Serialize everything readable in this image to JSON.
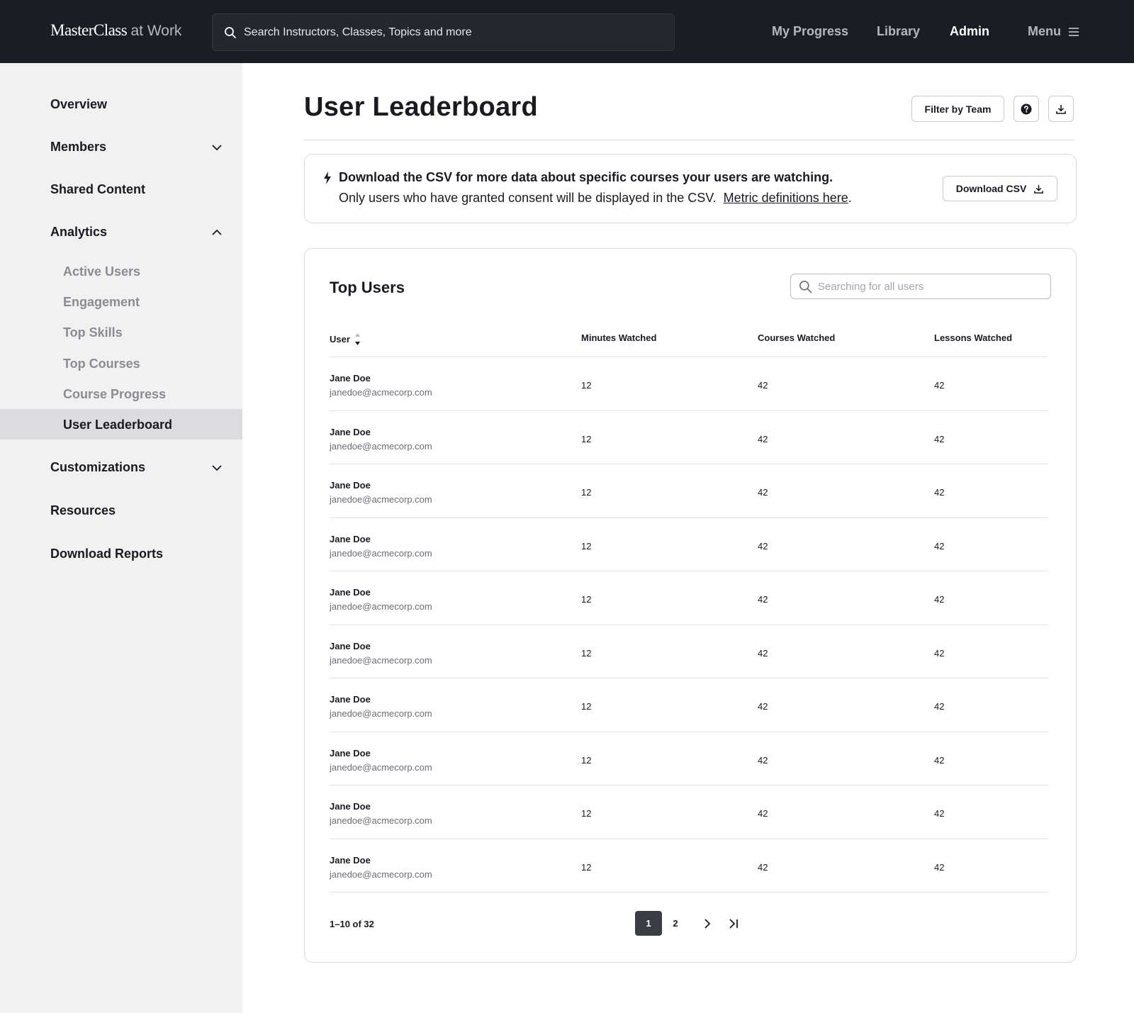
{
  "header": {
    "brand": "MasterClass",
    "brand_suffix": "at Work",
    "search_placeholder": "Search Instructors, Classes, Topics and more",
    "nav": [
      {
        "label": "My Progress"
      },
      {
        "label": "Library"
      },
      {
        "label": "Admin",
        "active": true
      }
    ],
    "menu_label": "Menu"
  },
  "sidebar": {
    "items": [
      {
        "label": "Overview"
      },
      {
        "label": "Members",
        "expandable": true,
        "expanded": false
      },
      {
        "label": "Shared Content"
      },
      {
        "label": "Analytics",
        "expandable": true,
        "expanded": true
      },
      {
        "label": "Customizations",
        "expandable": true,
        "expanded": false
      },
      {
        "label": "Resources"
      },
      {
        "label": "Download Reports"
      }
    ],
    "analytics_subitems": [
      {
        "label": "Active Users"
      },
      {
        "label": "Engagement"
      },
      {
        "label": "Top Skills"
      },
      {
        "label": "Top Courses"
      },
      {
        "label": "Course Progress"
      },
      {
        "label": "User Leaderboard",
        "active": true
      }
    ]
  },
  "main": {
    "title": "User Leaderboard",
    "filter_label": "Filter by Team",
    "info": {
      "headline": "Download the CSV for more data about specific courses your users are watching.",
      "text": "Only users who have granted consent will be displayed in the CSV.",
      "link_text": "Metric definitions here",
      "link_suffix": ".",
      "download_label": "Download CSV"
    },
    "table": {
      "title": "Top Users",
      "search_placeholder": "Searching for all users",
      "columns": [
        "User",
        "Minutes Watched",
        "Courses Watched",
        "Lessons Watched"
      ],
      "rows": [
        {
          "name": "Jane Doe",
          "email": "janedoe@acmecorp.com",
          "minutes": "12",
          "courses": "42",
          "lessons": "42"
        },
        {
          "name": "Jane Doe",
          "email": "janedoe@acmecorp.com",
          "minutes": "12",
          "courses": "42",
          "lessons": "42"
        },
        {
          "name": "Jane Doe",
          "email": "janedoe@acmecorp.com",
          "minutes": "12",
          "courses": "42",
          "lessons": "42"
        },
        {
          "name": "Jane Doe",
          "email": "janedoe@acmecorp.com",
          "minutes": "12",
          "courses": "42",
          "lessons": "42"
        },
        {
          "name": "Jane Doe",
          "email": "janedoe@acmecorp.com",
          "minutes": "12",
          "courses": "42",
          "lessons": "42"
        },
        {
          "name": "Jane Doe",
          "email": "janedoe@acmecorp.com",
          "minutes": "12",
          "courses": "42",
          "lessons": "42"
        },
        {
          "name": "Jane Doe",
          "email": "janedoe@acmecorp.com",
          "minutes": "12",
          "courses": "42",
          "lessons": "42"
        },
        {
          "name": "Jane Doe",
          "email": "janedoe@acmecorp.com",
          "minutes": "12",
          "courses": "42",
          "lessons": "42"
        },
        {
          "name": "Jane Doe",
          "email": "janedoe@acmecorp.com",
          "minutes": "12",
          "courses": "42",
          "lessons": "42"
        },
        {
          "name": "Jane Doe",
          "email": "janedoe@acmecorp.com",
          "minutes": "12",
          "courses": "42",
          "lessons": "42"
        }
      ],
      "pagination": {
        "range_text": "1–10 of 32",
        "pages": [
          "1",
          "2"
        ],
        "current_page": "1"
      }
    }
  },
  "icons": {
    "search": "search-icon",
    "menu": "hamburger-icon",
    "help": "help-circle-icon",
    "download": "download-icon",
    "bolt": "lightning-icon",
    "sort": "sort-icon",
    "next": "chevron-right-icon",
    "last": "last-page-icon",
    "expand": "chevron-down-icon",
    "collapse": "chevron-up-icon"
  },
  "colors": {
    "topbar_bg": "#1b1d24",
    "sidebar_bg": "#f1f1f2",
    "sidebar_active_bg": "#dcdcde",
    "pager_active_bg": "#3b3d44"
  }
}
